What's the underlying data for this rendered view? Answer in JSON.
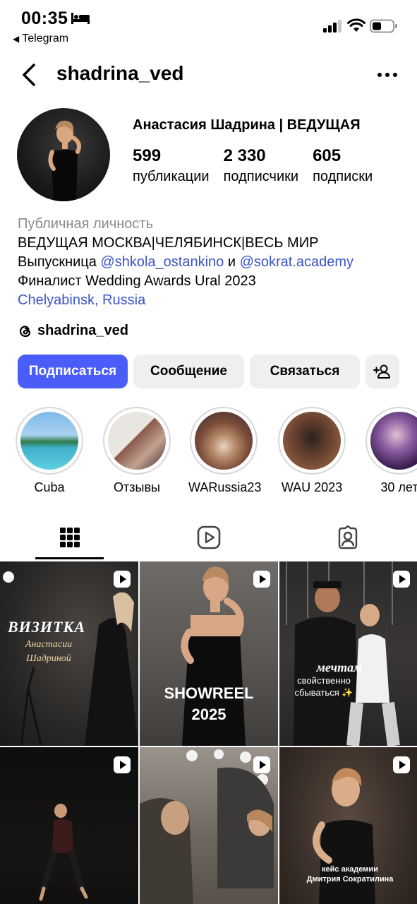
{
  "status_bar": {
    "time": "00:35",
    "back_app": "Telegram"
  },
  "nav": {
    "username": "shadrina_ved"
  },
  "profile": {
    "full_name": "Анастасия Шадрина | ВЕДУЩАЯ",
    "stats": [
      {
        "value": "599",
        "label": "публикации"
      },
      {
        "value": "2 330",
        "label": "подписчики"
      },
      {
        "value": "605",
        "label": "подписки"
      }
    ],
    "category": "Публичная личность",
    "bio_line1": "ВЕДУЩАЯ МОСКВА|ЧЕЛЯБИНСК|ВЕСЬ МИР",
    "bio_line2_prefix": "Выпускница ",
    "bio_mention1": "@shkola_ostankino",
    "bio_line2_mid": " и ",
    "bio_mention2": "@sokrat.academy",
    "bio_line3": "Финалист Wedding Awards Ural 2023",
    "location": "Chelyabinsk, Russia",
    "threads_handle": "shadrina_ved"
  },
  "buttons": {
    "follow": "Подписаться",
    "message": "Сообщение",
    "contact": "Связаться"
  },
  "highlights": [
    {
      "label": "Cuba"
    },
    {
      "label": "Отзывы"
    },
    {
      "label": "WARussia23"
    },
    {
      "label": "WAU 2023"
    },
    {
      "label": "30 лет"
    }
  ],
  "tabs": [
    "grid-icon",
    "reels-icon",
    "tagged-icon"
  ],
  "posts": [
    {
      "title": "ВИЗИТКА",
      "subtitle": "Анастасии Шадриной"
    },
    {
      "title": "SHOWREEL",
      "subtitle": "2025"
    },
    {
      "title": "мечтам",
      "subtitle": "свойственно сбываться ✨"
    },
    {
      "title": "",
      "subtitle": ""
    },
    {
      "title": "",
      "subtitle": ""
    },
    {
      "title": "кейс академии",
      "subtitle": "Дмитрия Сократилина"
    }
  ],
  "colors": {
    "accent": "#4a5df9",
    "link": "#3a55c9",
    "secondary_button": "#efeff2"
  }
}
